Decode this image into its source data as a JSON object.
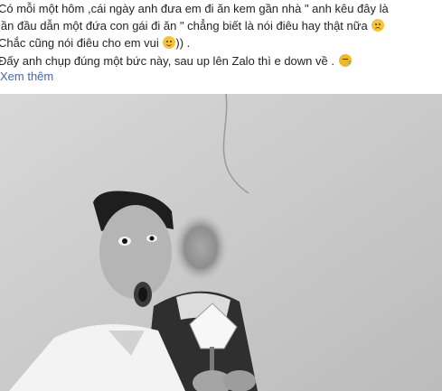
{
  "post": {
    "lines": [
      "Có mỗi một hôm ,cái ngày anh đưa em đi ăn kem gần nhà \" anh kêu đây là",
      "lần đầu dẫn một đứa con gái đi ăn \" chẳng biết là nói điêu hay thật nữa",
      "Chắc cũng nói điêu cho em vui",
      "Đấy anh chụp đúng một bức này, sau up lên Zalo thì e down về ."
    ],
    "line3_suffix": ")) .",
    "see_more": "Xem thêm",
    "emojis": [
      "unamused-face-icon",
      "smiling-face-icon",
      "sleepy-face-icon"
    ]
  },
  "photo": {
    "description_tag": "selfie-photo",
    "style": "black-and-white"
  },
  "colors": {
    "text": "#1d2129",
    "link": "#4267b2",
    "emoji": "#f5c33b"
  }
}
